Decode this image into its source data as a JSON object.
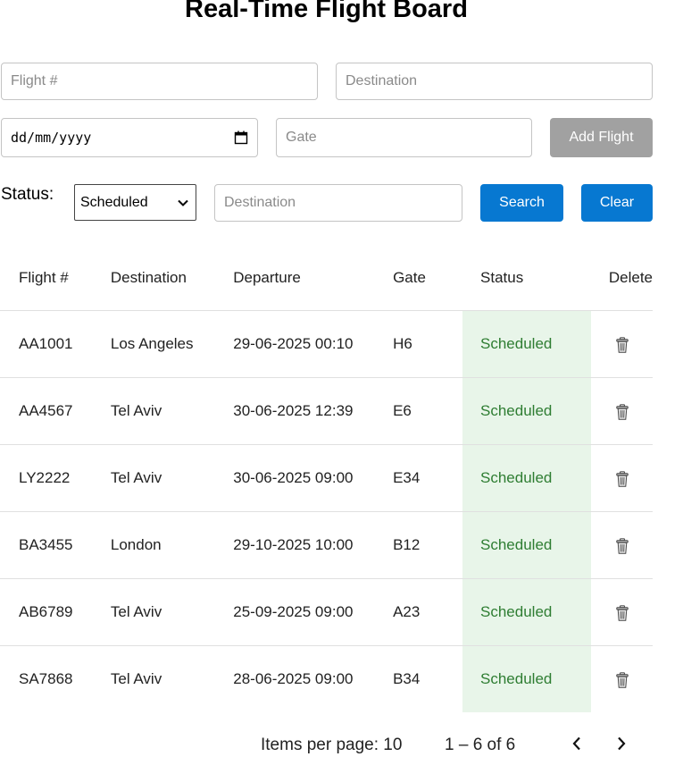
{
  "title": "Real-Time Flight Board",
  "form": {
    "flight_placeholder": "Flight #",
    "destination_placeholder": "Destination",
    "date_placeholder": "dd/mm/yyyy",
    "gate_placeholder": "Gate",
    "add_button": "Add Flight"
  },
  "filter": {
    "status_label": "Status:",
    "status_value": "Scheduled",
    "destination_placeholder": "Destination",
    "search_button": "Search",
    "clear_button": "Clear"
  },
  "table": {
    "headers": [
      "Flight #",
      "Destination",
      "Departure",
      "Gate",
      "Status",
      "Delete"
    ],
    "rows": [
      {
        "flight": "AA1001",
        "destination": "Los Angeles",
        "departure": "29-06-2025 00:10",
        "gate": "H6",
        "status": "Scheduled"
      },
      {
        "flight": "AA4567",
        "destination": "Tel Aviv",
        "departure": "30-06-2025 12:39",
        "gate": "E6",
        "status": "Scheduled"
      },
      {
        "flight": "LY2222",
        "destination": "Tel Aviv",
        "departure": "30-06-2025 09:00",
        "gate": "E34",
        "status": "Scheduled"
      },
      {
        "flight": "BA3455",
        "destination": "London",
        "departure": "29-10-2025 10:00",
        "gate": "B12",
        "status": "Scheduled"
      },
      {
        "flight": "AB6789",
        "destination": "Tel Aviv",
        "departure": "25-09-2025 09:00",
        "gate": "A23",
        "status": "Scheduled"
      },
      {
        "flight": "SA7868",
        "destination": "Tel Aviv",
        "departure": "28-06-2025 09:00",
        "gate": "B34",
        "status": "Scheduled"
      }
    ]
  },
  "pagination": {
    "items_per_page": "Items per page: 10",
    "range": "1 – 6 of 6"
  },
  "colors": {
    "primary_button": "#0778d1",
    "disabled_button": "#a1a1a1",
    "status_bg": "#e8f5e9",
    "status_text": "#2e7d32"
  },
  "icons": {
    "calendar": "calendar-icon",
    "delete": "trash-icon",
    "prev": "chevron-left-icon",
    "next": "chevron-right-icon",
    "dropdown": "chevron-down-icon"
  }
}
